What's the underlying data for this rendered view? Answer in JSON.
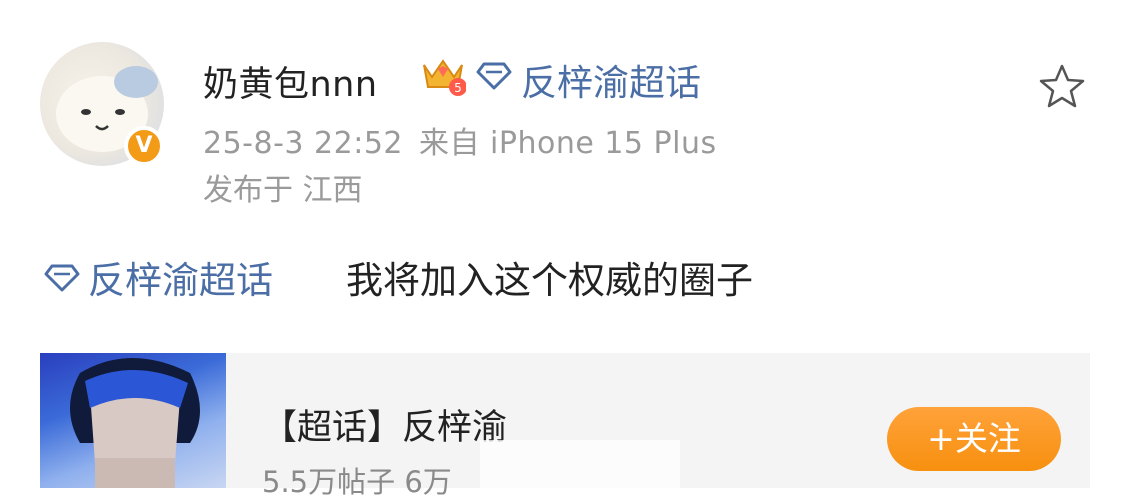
{
  "post": {
    "author": {
      "name": "奶黄包nnn",
      "badge_level": "5",
      "verified_mark": "V"
    },
    "header_topic": "反梓渝超话",
    "time": "25-8-3 22:52",
    "source": "来自 iPhone 15 Plus",
    "location": "发布于 江西",
    "body_topic": "反梓渝超话",
    "body_text": "我将加入这个权威的圈子"
  },
  "card": {
    "title": "【超话】反梓渝",
    "stats": "5.5万帖子 6万",
    "follow_label": "+关注"
  },
  "colors": {
    "link": "#4a6ea5",
    "accent": "#f7900f",
    "muted": "#9a9a9a"
  }
}
